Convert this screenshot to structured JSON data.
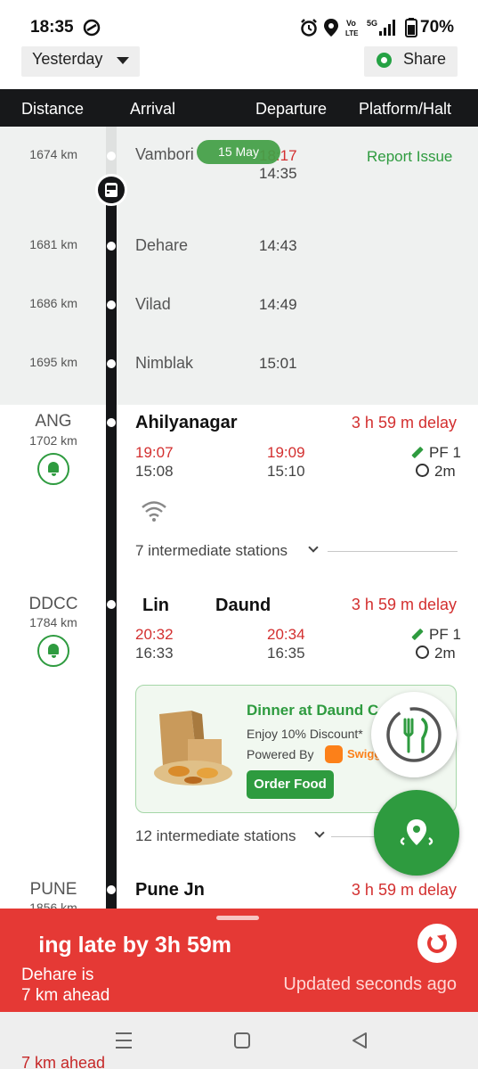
{
  "status_bar": {
    "time": "18:35",
    "volte": "Vo LTE",
    "network": "5G",
    "battery": "70%"
  },
  "toolbar": {
    "day_select": "Yesterday",
    "share_label": "Share"
  },
  "columns": {
    "distance": "Distance",
    "arrival": "Arrival",
    "departure": "Departure",
    "platform": "Platform/Halt"
  },
  "passed_stations": [
    {
      "km": "1674 km",
      "name": "Vambori",
      "time_red": "18:17",
      "time": "14:35"
    },
    {
      "km": "1681 km",
      "name": "Dehare",
      "time": "14:43"
    },
    {
      "km": "1686 km",
      "name": "Vilad",
      "time": "14:49"
    },
    {
      "km": "1695 km",
      "name": "Nimblak",
      "time": "15:01"
    }
  ],
  "date_pill": "15 May",
  "report_issue": "Report Issue",
  "stations": [
    {
      "code": "ANG",
      "km": "1702 km",
      "name": "Ahilyanagar",
      "delay": "3 h 59 m delay",
      "arr_actual": "19:07",
      "arr_sched": "15:08",
      "dep_actual": "19:09",
      "dep_sched": "15:10",
      "pf": "PF 1",
      "halt": "2m",
      "intermediate": "7 intermediate stations"
    },
    {
      "code": "DDCC",
      "km": "1784 km",
      "name": "Daund",
      "name_prefix": "Lin",
      "delay": "3 h 59 m delay",
      "arr_actual": "20:32",
      "arr_sched": "16:33",
      "dep_actual": "20:34",
      "dep_sched": "16:35",
      "pf": "PF 1",
      "halt": "2m",
      "intermediate": "12 intermediate stations"
    },
    {
      "code": "PUNE",
      "km": "1856 km",
      "name": "Pune Jn",
      "delay": "3 h 59 m delay"
    }
  ],
  "food_card": {
    "title": "Dinner at Daund C",
    "discount": "Enjoy 10% Discount*",
    "powered_by": "Powered By",
    "partner": "Swiggy",
    "button": "Order Food"
  },
  "banner": {
    "running": "ing late by 3h 59m",
    "ahead_line1": "Dehare is",
    "ahead_line2": "7 km ahead",
    "updated": "Updated seconds  ago",
    "peek": "7 km ahead"
  },
  "colors": {
    "accent_green": "#2e9b3f",
    "delay_red": "#d32f2f",
    "banner_red": "#e53935",
    "header_black": "#17181a"
  },
  "icons": [
    "whatsapp-icon",
    "dropdown-arrow-icon",
    "train-icon",
    "bell-icon",
    "pencil-icon",
    "timer-icon",
    "wifi-icon",
    "chevron-down-icon",
    "food-icon",
    "location-pin-icon",
    "refresh-icon"
  ]
}
